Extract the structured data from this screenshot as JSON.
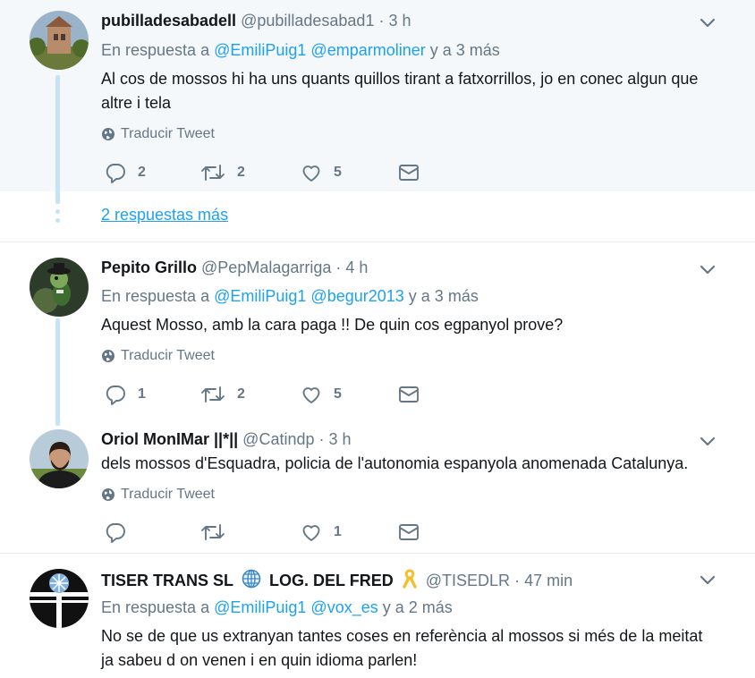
{
  "tweets": [
    {
      "name": "pubilladesabadell",
      "handle": "@pubilladesabad1",
      "time": "3 h",
      "reply_prefix": "En respuesta a",
      "mentions": [
        "@EmiliPuig1",
        "@emparmoliner"
      ],
      "reply_suffix": "y a 3 más",
      "text": "Al cos de mossos hi ha uns quants quillos tirant a fatxorrillos, jo en conec algun que altre i tela",
      "translate": "Traducir Tweet",
      "replies": "2",
      "retweets": "2",
      "likes": "5"
    },
    {
      "name": "Pepito Grillo",
      "handle": "@PepMalagarriga",
      "time": "4 h",
      "reply_prefix": "En respuesta a",
      "mentions": [
        "@EmiliPuig1",
        "@begur2013"
      ],
      "reply_suffix": "y a 3 más",
      "text": "Aquest Mosso, amb la cara paga !! De quin cos egpanyol prove?",
      "translate": "Traducir Tweet",
      "replies": "1",
      "retweets": "2",
      "likes": "5"
    },
    {
      "name": "Oriol MonIMar ||*||",
      "handle": "@Catindp",
      "time": "3 h",
      "text": "dels mossos d'Esquadra, policia de l'autonomia espanyola anomenada Catalunya.",
      "translate": "Traducir Tweet",
      "replies": "",
      "retweets": "",
      "likes": "1"
    },
    {
      "name_part1": "TISER TRANS SL",
      "name_part2": "LOG. DEL FRED",
      "handle": "@TISEDLR",
      "time": "47 min",
      "reply_prefix": "En respuesta a",
      "mentions": [
        "@EmiliPuig1",
        "@vox_es"
      ],
      "reply_suffix": "y a 2 más",
      "text": "No se de que us extranyan tantes coses en referència al mossos si més de la meitat ja sabeu d on venen i en quin idioma parlen!"
    }
  ],
  "more_replies": "2 respuestas más",
  "separator": "·",
  "icons": {
    "reply": "reply-icon",
    "retweet": "retweet-icon",
    "like": "heart-icon",
    "dm": "envelope-icon",
    "globe": "globe-icon",
    "chevron": "chevron-down-icon"
  },
  "colors": {
    "link": "#1da1f2",
    "muted": "#657786",
    "text": "#14171a",
    "highlight_bg": "#f5f8fa",
    "thread_line": "#c4e4f6"
  }
}
